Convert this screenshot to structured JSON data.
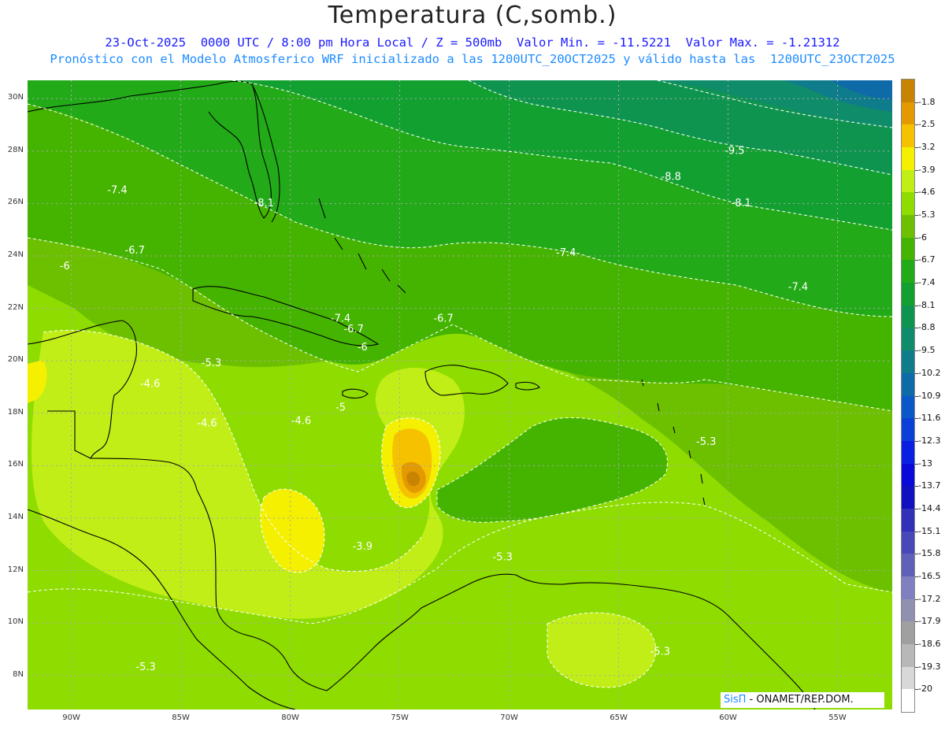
{
  "header": {
    "title": "Temperatura (C,somb.)",
    "subtitle_line1": "23-Oct-2025  0000 UTC / 8:00 pm Hora Local / Z = 500mb  Valor Min. = -11.5221  Valor Max. = -1.21312",
    "subtitle_line2": "Pronóstico con el Modelo Atmosferico WRF inicializado a las 1200UTC_20OCT2025 y válido hasta las  1200UTC_23OCT2025"
  },
  "map": {
    "lat_labels": [
      "30N",
      "28N",
      "26N",
      "24N",
      "22N",
      "20N",
      "18N",
      "16N",
      "14N",
      "12N",
      "10N",
      "8N"
    ],
    "lon_labels": [
      "90W",
      "85W",
      "80W",
      "75W",
      "70W",
      "65W",
      "60W",
      "55W"
    ],
    "lat_values": [
      30,
      28,
      26,
      24,
      22,
      20,
      18,
      16,
      14,
      12,
      10,
      8
    ],
    "lon_values": [
      -90,
      -85,
      -80,
      -75,
      -70,
      -65,
      -60,
      -55
    ],
    "extent": {
      "lon_min": -92.0,
      "lon_max": -52.5,
      "lat_min": 6.7,
      "lat_max": 30.7
    },
    "contour_labels": [
      {
        "text": "-7.4",
        "lon": -87.9,
        "lat": 26.5
      },
      {
        "text": "-8.1",
        "lon": -81.2,
        "lat": 26.0
      },
      {
        "text": "-6.7",
        "lon": -87.1,
        "lat": 24.2
      },
      {
        "text": "-6",
        "lon": -90.3,
        "lat": 23.6
      },
      {
        "text": "-9.5",
        "lon": -59.7,
        "lat": 28.0
      },
      {
        "text": "-8.8",
        "lon": -62.6,
        "lat": 27.0
      },
      {
        "text": "-8.1",
        "lon": -59.4,
        "lat": 26.0
      },
      {
        "text": "-7.4",
        "lon": -67.4,
        "lat": 24.1
      },
      {
        "text": "-7.4",
        "lon": -56.8,
        "lat": 22.8
      },
      {
        "text": "-7.4",
        "lon": -77.7,
        "lat": 21.6
      },
      {
        "text": "-6.7",
        "lon": -77.1,
        "lat": 21.2
      },
      {
        "text": "-6",
        "lon": -76.7,
        "lat": 20.5
      },
      {
        "text": "-6.7",
        "lon": -73.0,
        "lat": 21.6
      },
      {
        "text": "-5.3",
        "lon": -83.6,
        "lat": 19.9
      },
      {
        "text": "-4.6",
        "lon": -86.4,
        "lat": 19.1
      },
      {
        "text": "-5",
        "lon": -77.7,
        "lat": 18.2
      },
      {
        "text": "-4.6",
        "lon": -79.5,
        "lat": 17.7
      },
      {
        "text": "-4.6",
        "lon": -83.8,
        "lat": 17.6
      },
      {
        "text": "-5.3",
        "lon": -61.0,
        "lat": 16.9
      },
      {
        "text": "-3.9",
        "lon": -76.7,
        "lat": 12.9
      },
      {
        "text": "-5.3",
        "lon": -70.3,
        "lat": 12.5
      },
      {
        "text": "-5.3",
        "lon": -63.1,
        "lat": 8.9
      },
      {
        "text": "-5.3",
        "lon": -86.6,
        "lat": 8.3
      }
    ],
    "contour_label_color": "#ffffff",
    "coast_color": "#000000",
    "grid_color": "#a8a8a8"
  },
  "colorbar": {
    "labels": [
      "-1.8",
      "-2.5",
      "-3.2",
      "-3.9",
      "-4.6",
      "-5.3",
      "-6",
      "-6.7",
      "-7.4",
      "-8.1",
      "-8.8",
      "-9.5",
      "-10.2",
      "-10.9",
      "-11.6",
      "-12.3",
      "-13",
      "-13.7",
      "-14.4",
      "-15.1",
      "-15.8",
      "-16.5",
      "-17.2",
      "-17.9",
      "-18.6",
      "-19.3",
      "-20"
    ],
    "colors": [
      "#c88400",
      "#e29a00",
      "#f6c200",
      "#f4f000",
      "#c2ee18",
      "#8edc00",
      "#6cc000",
      "#44b400",
      "#22aa18",
      "#12a030",
      "#0f9450",
      "#0f8c6a",
      "#0f7c8c",
      "#0f6aa8",
      "#0a58c8",
      "#0a40d8",
      "#0a20e0",
      "#0a0ad8",
      "#1010c0",
      "#3030b8",
      "#4848b8",
      "#6060b8",
      "#8080c0",
      "#9090b0",
      "#a0a0a0",
      "#b8b8b8",
      "#d8d8d8",
      "#ffffff"
    ]
  },
  "credit": {
    "brand": "SisΠ",
    "text": " - ONAMET/REP.DOM."
  }
}
